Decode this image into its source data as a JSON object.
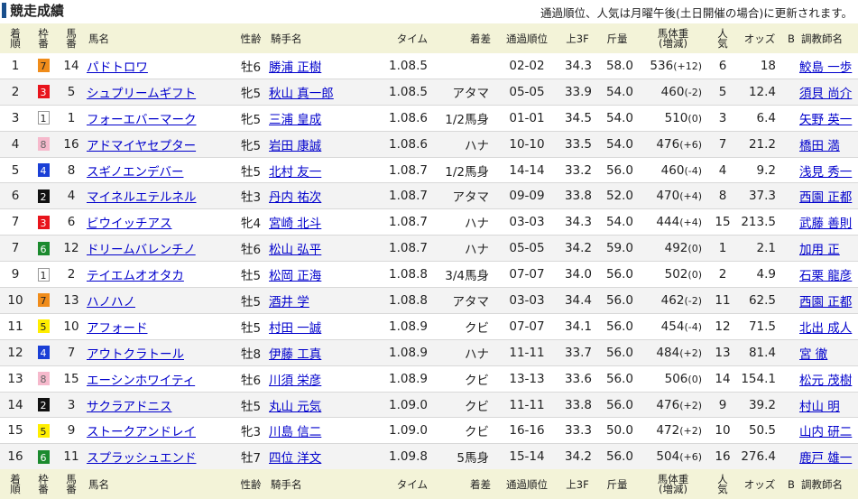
{
  "title": "競走成績",
  "note": "通過順位、人気は月曜午後(土日開催の場合)に更新されます。",
  "headers": {
    "rank": [
      "着",
      "順"
    ],
    "frame": [
      "枠",
      "番"
    ],
    "horse_no": [
      "馬",
      "番"
    ],
    "horse": "馬名",
    "sex_age": "性齢",
    "jockey": "騎手名",
    "time": "タイム",
    "margin": "着差",
    "passing": "通過順位",
    "last3f": "上3F",
    "weight": "斤量",
    "body_weight": [
      "馬体重",
      "(増減)"
    ],
    "popularity": [
      "人",
      "気"
    ],
    "odds": "オッズ",
    "b": "B",
    "trainer": "調教師名"
  },
  "frame_colors": {
    "1": {
      "bg": "#ffffff",
      "fg": "#222222",
      "border": "#999999"
    },
    "2": {
      "bg": "#111111",
      "fg": "#ffffff",
      "border": "#111111"
    },
    "3": {
      "bg": "#e8141c",
      "fg": "#ffffff",
      "border": "#e8141c"
    },
    "4": {
      "bg": "#1a3fd6",
      "fg": "#ffffff",
      "border": "#1a3fd6"
    },
    "5": {
      "bg": "#ffee00",
      "fg": "#222222",
      "border": "#ffee00"
    },
    "6": {
      "bg": "#1b8a2e",
      "fg": "#ffffff",
      "border": "#1b8a2e"
    },
    "7": {
      "bg": "#f08c1a",
      "fg": "#222222",
      "border": "#f08c1a"
    },
    "8": {
      "bg": "#f6b9cc",
      "fg": "#666666",
      "border": "#f6b9cc"
    }
  },
  "rows": [
    {
      "rank": "1",
      "frame": "7",
      "horse_no": "14",
      "horse": "パドトロワ",
      "sex_age": "牡6",
      "jockey": "勝浦 正樹",
      "time": "1.08.5",
      "margin": "",
      "passing": "02-02",
      "last3f": "34.3",
      "weight": "58.0",
      "bw": "536",
      "bw_chg": "(+12)",
      "pop": "6",
      "odds": "18",
      "b": "",
      "trainer": "鮫島 一歩"
    },
    {
      "rank": "2",
      "frame": "3",
      "horse_no": "5",
      "horse": "シュプリームギフト",
      "sex_age": "牝5",
      "jockey": "秋山 真一郎",
      "time": "1.08.5",
      "margin": "アタマ",
      "passing": "05-05",
      "last3f": "33.9",
      "weight": "54.0",
      "bw": "460",
      "bw_chg": "(-2)",
      "pop": "5",
      "odds": "12.4",
      "b": "",
      "trainer": "須貝 尚介"
    },
    {
      "rank": "3",
      "frame": "1",
      "horse_no": "1",
      "horse": "フォーエバーマーク",
      "sex_age": "牝5",
      "jockey": "三浦 皇成",
      "time": "1.08.6",
      "margin": "1/2馬身",
      "passing": "01-01",
      "last3f": "34.5",
      "weight": "54.0",
      "bw": "510",
      "bw_chg": "(0)",
      "pop": "3",
      "odds": "6.4",
      "b": "",
      "trainer": "矢野 英一"
    },
    {
      "rank": "4",
      "frame": "8",
      "horse_no": "16",
      "horse": "アドマイヤセプター",
      "sex_age": "牝5",
      "jockey": "岩田 康誠",
      "time": "1.08.6",
      "margin": "ハナ",
      "passing": "10-10",
      "last3f": "33.5",
      "weight": "54.0",
      "bw": "476",
      "bw_chg": "(+6)",
      "pop": "7",
      "odds": "21.2",
      "b": "",
      "trainer": "橋田 満"
    },
    {
      "rank": "5",
      "frame": "4",
      "horse_no": "8",
      "horse": "スギノエンデバー",
      "sex_age": "牡5",
      "jockey": "北村 友一",
      "time": "1.08.7",
      "margin": "1/2馬身",
      "passing": "14-14",
      "last3f": "33.2",
      "weight": "56.0",
      "bw": "460",
      "bw_chg": "(-4)",
      "pop": "4",
      "odds": "9.2",
      "b": "",
      "trainer": "浅見 秀一"
    },
    {
      "rank": "6",
      "frame": "2",
      "horse_no": "4",
      "horse": "マイネルエテルネル",
      "sex_age": "牡3",
      "jockey": "丹内 祐次",
      "time": "1.08.7",
      "margin": "アタマ",
      "passing": "09-09",
      "last3f": "33.8",
      "weight": "52.0",
      "bw": "470",
      "bw_chg": "(+4)",
      "pop": "8",
      "odds": "37.3",
      "b": "",
      "trainer": "西園 正都"
    },
    {
      "rank": "7",
      "frame": "3",
      "horse_no": "6",
      "horse": "ビウイッチアス",
      "sex_age": "牝4",
      "jockey": "宮崎 北斗",
      "time": "1.08.7",
      "margin": "ハナ",
      "passing": "03-03",
      "last3f": "34.3",
      "weight": "54.0",
      "bw": "444",
      "bw_chg": "(+4)",
      "pop": "15",
      "odds": "213.5",
      "b": "",
      "trainer": "武藤 善則"
    },
    {
      "rank": "7",
      "frame": "6",
      "horse_no": "12",
      "horse": "ドリームバレンチノ",
      "sex_age": "牡6",
      "jockey": "松山 弘平",
      "time": "1.08.7",
      "margin": "ハナ",
      "passing": "05-05",
      "last3f": "34.2",
      "weight": "59.0",
      "bw": "492",
      "bw_chg": "(0)",
      "pop": "1",
      "odds": "2.1",
      "b": "",
      "trainer": "加用 正"
    },
    {
      "rank": "9",
      "frame": "1",
      "horse_no": "2",
      "horse": "テイエムオオタカ",
      "sex_age": "牡5",
      "jockey": "松岡 正海",
      "time": "1.08.8",
      "margin": "3/4馬身",
      "passing": "07-07",
      "last3f": "34.0",
      "weight": "56.0",
      "bw": "502",
      "bw_chg": "(0)",
      "pop": "2",
      "odds": "4.9",
      "b": "",
      "trainer": "石栗 龍彦"
    },
    {
      "rank": "10",
      "frame": "7",
      "horse_no": "13",
      "horse": "ハノハノ",
      "sex_age": "牡5",
      "jockey": "酒井 学",
      "time": "1.08.8",
      "margin": "アタマ",
      "passing": "03-03",
      "last3f": "34.4",
      "weight": "56.0",
      "bw": "462",
      "bw_chg": "(-2)",
      "pop": "11",
      "odds": "62.5",
      "b": "",
      "trainer": "西園 正都"
    },
    {
      "rank": "11",
      "frame": "5",
      "horse_no": "10",
      "horse": "アフォード",
      "sex_age": "牡5",
      "jockey": "村田 一誠",
      "time": "1.08.9",
      "margin": "クビ",
      "passing": "07-07",
      "last3f": "34.1",
      "weight": "56.0",
      "bw": "454",
      "bw_chg": "(-4)",
      "pop": "12",
      "odds": "71.5",
      "b": "",
      "trainer": "北出 成人"
    },
    {
      "rank": "12",
      "frame": "4",
      "horse_no": "7",
      "horse": "アウトクラトール",
      "sex_age": "牡8",
      "jockey": "伊藤 工真",
      "time": "1.08.9",
      "margin": "ハナ",
      "passing": "11-11",
      "last3f": "33.7",
      "weight": "56.0",
      "bw": "484",
      "bw_chg": "(+2)",
      "pop": "13",
      "odds": "81.4",
      "b": "",
      "trainer": "宮 徹"
    },
    {
      "rank": "13",
      "frame": "8",
      "horse_no": "15",
      "horse": "エーシンホワイティ",
      "sex_age": "牡6",
      "jockey": "川須 栄彦",
      "time": "1.08.9",
      "margin": "クビ",
      "passing": "13-13",
      "last3f": "33.6",
      "weight": "56.0",
      "bw": "506",
      "bw_chg": "(0)",
      "pop": "14",
      "odds": "154.1",
      "b": "",
      "trainer": "松元 茂樹"
    },
    {
      "rank": "14",
      "frame": "2",
      "horse_no": "3",
      "horse": "サクラアドニス",
      "sex_age": "牡5",
      "jockey": "丸山 元気",
      "time": "1.09.0",
      "margin": "クビ",
      "passing": "11-11",
      "last3f": "33.8",
      "weight": "56.0",
      "bw": "476",
      "bw_chg": "(+2)",
      "pop": "9",
      "odds": "39.2",
      "b": "",
      "trainer": "村山 明"
    },
    {
      "rank": "15",
      "frame": "5",
      "horse_no": "9",
      "horse": "ストークアンドレイ",
      "sex_age": "牝3",
      "jockey": "川島 信二",
      "time": "1.09.0",
      "margin": "クビ",
      "passing": "16-16",
      "last3f": "33.3",
      "weight": "50.0",
      "bw": "472",
      "bw_chg": "(+2)",
      "pop": "10",
      "odds": "50.5",
      "b": "",
      "trainer": "山内 研二"
    },
    {
      "rank": "16",
      "frame": "6",
      "horse_no": "11",
      "horse": "スプラッシュエンド",
      "sex_age": "牡7",
      "jockey": "四位 洋文",
      "time": "1.09.8",
      "margin": "5馬身",
      "passing": "15-14",
      "last3f": "34.2",
      "weight": "56.0",
      "bw": "504",
      "bw_chg": "(+6)",
      "pop": "16",
      "odds": "276.4",
      "b": "",
      "trainer": "鹿戸 雄一"
    }
  ]
}
